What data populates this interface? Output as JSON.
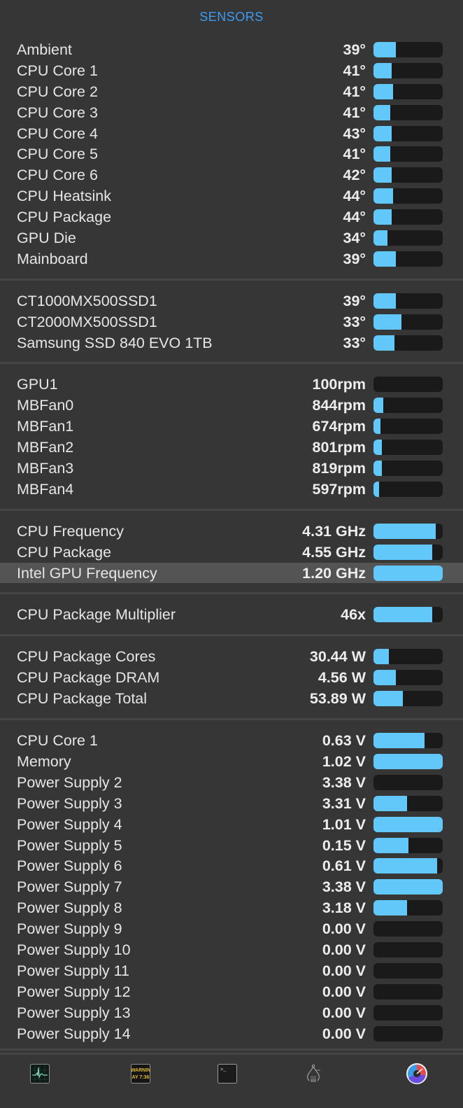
{
  "header": {
    "title": "SENSORS"
  },
  "colors": {
    "accent": "#3d9bf0",
    "bar_fill": "#62c8fa",
    "bar_track": "#1a1a1a",
    "background": "#363636",
    "highlight": "#545454"
  },
  "sections": [
    {
      "name": "temperatures",
      "rows": [
        {
          "label": "Ambient",
          "value": "39°",
          "fill": 0.32
        },
        {
          "label": "CPU Core 1",
          "value": "41°",
          "fill": 0.26
        },
        {
          "label": "CPU Core 2",
          "value": "41°",
          "fill": 0.28
        },
        {
          "label": "CPU Core 3",
          "value": "41°",
          "fill": 0.24
        },
        {
          "label": "CPU Core 4",
          "value": "43°",
          "fill": 0.26
        },
        {
          "label": "CPU Core 5",
          "value": "41°",
          "fill": 0.24
        },
        {
          "label": "CPU Core 6",
          "value": "42°",
          "fill": 0.26
        },
        {
          "label": "CPU Heatsink",
          "value": "44°",
          "fill": 0.28
        },
        {
          "label": "CPU Package",
          "value": "44°",
          "fill": 0.26
        },
        {
          "label": "GPU Die",
          "value": "34°",
          "fill": 0.2
        },
        {
          "label": "Mainboard",
          "value": "39°",
          "fill": 0.32
        }
      ]
    },
    {
      "name": "drives",
      "rows": [
        {
          "label": "CT1000MX500SSD1",
          "value": "39°",
          "fill": 0.32
        },
        {
          "label": "CT2000MX500SSD1",
          "value": "33°",
          "fill": 0.4
        },
        {
          "label": "Samsung SSD 840 EVO 1TB",
          "value": "33°",
          "fill": 0.3
        }
      ]
    },
    {
      "name": "fans",
      "rows": [
        {
          "label": "GPU1",
          "value": "100rpm",
          "fill": 0.0
        },
        {
          "label": "MBFan0",
          "value": "844rpm",
          "fill": 0.14
        },
        {
          "label": "MBFan1",
          "value": "674rpm",
          "fill": 0.1
        },
        {
          "label": "MBFan2",
          "value": "801rpm",
          "fill": 0.12
        },
        {
          "label": "MBFan3",
          "value": "819rpm",
          "fill": 0.12
        },
        {
          "label": "MBFan4",
          "value": "597rpm",
          "fill": 0.08
        }
      ]
    },
    {
      "name": "frequencies",
      "rows": [
        {
          "label": "CPU Frequency",
          "value": "4.31 GHz",
          "fill": 0.9
        },
        {
          "label": "CPU Package",
          "value": "4.55 GHz",
          "fill": 0.85
        },
        {
          "label": "Intel GPU Frequency",
          "value": "1.20 GHz",
          "fill": 1.0,
          "highlighted": true
        }
      ]
    },
    {
      "name": "multiplier",
      "rows": [
        {
          "label": "CPU Package Multiplier",
          "value": "46x",
          "fill": 0.85
        }
      ]
    },
    {
      "name": "power",
      "rows": [
        {
          "label": "CPU Package Cores",
          "value": "30.44 W",
          "fill": 0.22
        },
        {
          "label": "CPU Package DRAM",
          "value": "4.56 W",
          "fill": 0.32
        },
        {
          "label": "CPU Package Total",
          "value": "53.89 W",
          "fill": 0.42
        }
      ]
    },
    {
      "name": "voltages",
      "rows": [
        {
          "label": "CPU Core 1",
          "value": "0.63 V",
          "fill": 0.74
        },
        {
          "label": "Memory",
          "value": "1.02 V",
          "fill": 1.0
        },
        {
          "label": "Power Supply 2",
          "value": "3.38 V",
          "fill": 0.0
        },
        {
          "label": "Power Supply 3",
          "value": "3.31 V",
          "fill": 0.48
        },
        {
          "label": "Power Supply 4",
          "value": "1.01 V",
          "fill": 1.0
        },
        {
          "label": "Power Supply 5",
          "value": "0.15 V",
          "fill": 0.5
        },
        {
          "label": "Power Supply 6",
          "value": "0.61 V",
          "fill": 0.92
        },
        {
          "label": "Power Supply 7",
          "value": "3.38 V",
          "fill": 1.0
        },
        {
          "label": "Power Supply 8",
          "value": "3.18 V",
          "fill": 0.48
        },
        {
          "label": "Power Supply 9",
          "value": "0.00 V",
          "fill": 0.0
        },
        {
          "label": "Power Supply 10",
          "value": "0.00 V",
          "fill": 0.0
        },
        {
          "label": "Power Supply 11",
          "value": "0.00 V",
          "fill": 0.0
        },
        {
          "label": "Power Supply 12",
          "value": "0.00 V",
          "fill": 0.0
        },
        {
          "label": "Power Supply 13",
          "value": "0.00 V",
          "fill": 0.0
        },
        {
          "label": "Power Supply 14",
          "value": "0.00 V",
          "fill": 0.0
        }
      ]
    }
  ],
  "footer": {
    "icons": [
      {
        "name": "activity-monitor-icon"
      },
      {
        "name": "console-icon",
        "text_line1": "WARNIN",
        "text_line2": "AY 7:36"
      },
      {
        "name": "terminal-icon",
        "prompt": ">_"
      },
      {
        "name": "system-information-icon"
      },
      {
        "name": "istat-menus-icon"
      }
    ]
  }
}
